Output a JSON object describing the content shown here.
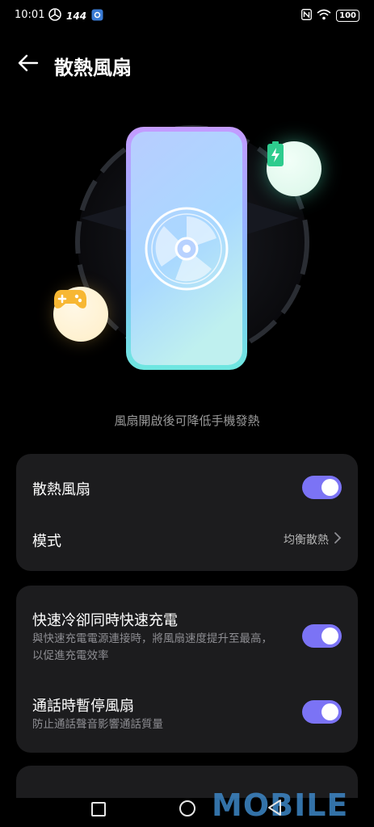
{
  "status_bar": {
    "time": "10:01",
    "refresh_rate": "144",
    "battery": "100",
    "icons": [
      "fan-status-icon",
      "settings-badge-icon",
      "nfc-icon",
      "wifi-icon",
      "battery-icon"
    ]
  },
  "header": {
    "title": "散熱風扇",
    "back_icon": "back-arrow-icon"
  },
  "hero": {
    "caption": "風扇開啟後可降低手機發熱",
    "icons": [
      "fan-icon",
      "gamepad-icon",
      "battery-charging-icon"
    ]
  },
  "settings": {
    "fan": {
      "label": "散熱風扇",
      "enabled": true
    },
    "mode": {
      "label": "模式",
      "value": "均衡散熱"
    },
    "fast_charge": {
      "label": "快速冷卻同時快速充電",
      "description": "與快速充電電源連接時，將風扇速度提升至最高，以促進充電效率",
      "enabled": true
    },
    "pause_on_call": {
      "label": "通話時暫停風扇",
      "description": "防止通話聲音影響通話質量",
      "enabled": true
    }
  },
  "colors": {
    "accent": "#7b73f5",
    "card": "#1c1c1e",
    "background": "#000000"
  },
  "watermark": "MOBILE"
}
